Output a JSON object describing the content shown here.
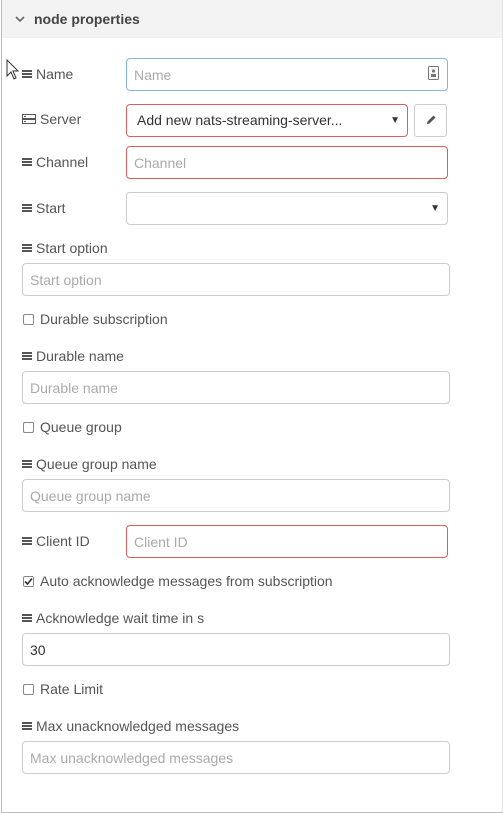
{
  "section": {
    "title": "node properties"
  },
  "fields": {
    "name": {
      "label": "Name",
      "placeholder": "Name",
      "value": ""
    },
    "server": {
      "label": "Server",
      "selected": "Add new nats-streaming-server..."
    },
    "channel": {
      "label": "Channel",
      "placeholder": "Channel"
    },
    "start": {
      "label": "Start",
      "selected": ""
    },
    "start_option": {
      "label": "Start option",
      "placeholder": "Start option"
    },
    "durable_subscription": {
      "label": "Durable subscription",
      "checked": false
    },
    "durable_name": {
      "label": "Durable name",
      "placeholder": "Durable name"
    },
    "queue_group": {
      "label": "Queue group",
      "checked": false
    },
    "queue_group_name": {
      "label": "Queue group name",
      "placeholder": "Queue group name"
    },
    "client_id": {
      "label": "Client ID",
      "placeholder": "Client ID"
    },
    "auto_ack": {
      "label": "Auto acknowledge messages from subscription",
      "checked": true
    },
    "ack_wait": {
      "label": "Acknowledge wait time in s",
      "value": "30"
    },
    "rate_limit": {
      "label": "Rate Limit",
      "checked": false
    },
    "max_unack": {
      "label": "Max unacknowledged messages",
      "placeholder": "Max unacknowledged messages"
    }
  },
  "icons": {
    "header": "chevron-down-icon",
    "label": "list-icon",
    "server": "server-icon",
    "edit": "pencil-icon",
    "input_addon": "vault-icon"
  },
  "colors": {
    "error_border": "#d6615f",
    "focus_border": "#85b5dd",
    "header_bg": "#f3f3f3"
  }
}
